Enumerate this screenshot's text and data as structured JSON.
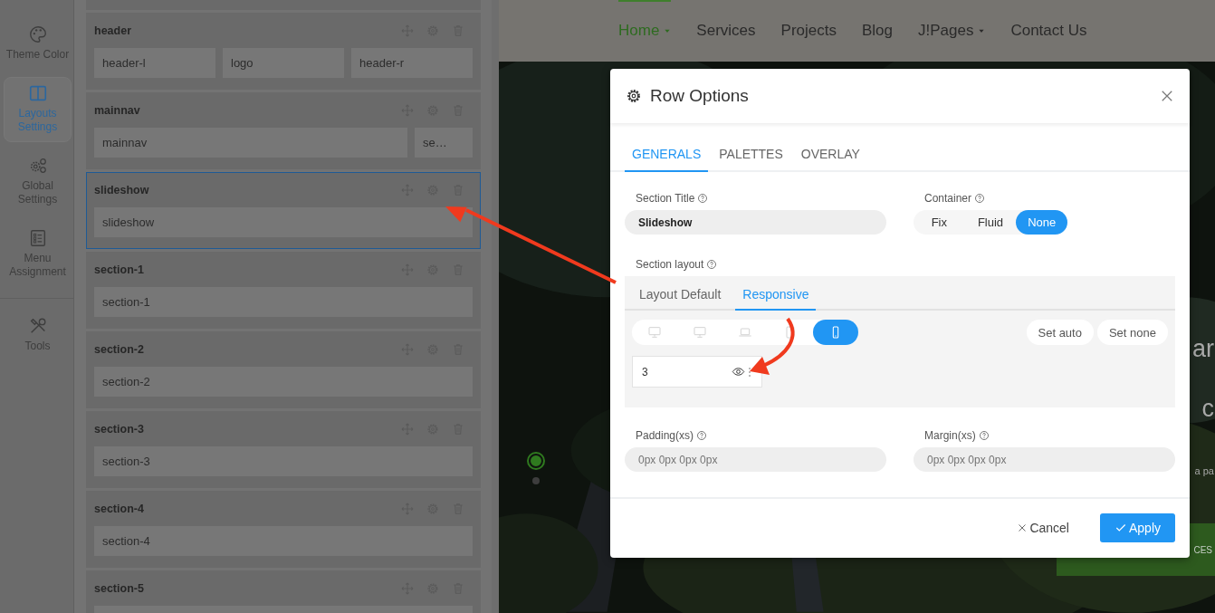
{
  "sidebar": {
    "items": [
      {
        "label": "Theme Color",
        "kind": "palette",
        "selected": false
      },
      {
        "label": "Layouts Settings",
        "kind": "columns",
        "selected": true
      },
      {
        "label": "Global Settings",
        "kind": "gears",
        "selected": false
      },
      {
        "label": "Menu Assignment",
        "kind": "checklist",
        "selected": false
      },
      {
        "label": "Tools",
        "kind": "tools",
        "selected": false
      }
    ]
  },
  "layout_rows": [
    {
      "title": "header",
      "selected": false,
      "columns": [
        "header-l",
        "logo",
        "header-r"
      ]
    },
    {
      "title": "mainnav",
      "selected": false,
      "columns": [
        "mainnav",
        "se…"
      ]
    },
    {
      "title": "slideshow",
      "selected": true,
      "columns": [
        "slideshow"
      ]
    },
    {
      "title": "section-1",
      "selected": false,
      "columns": [
        "section-1"
      ]
    },
    {
      "title": "section-2",
      "selected": false,
      "columns": [
        "section-2"
      ]
    },
    {
      "title": "section-3",
      "selected": false,
      "columns": [
        "section-3"
      ]
    },
    {
      "title": "section-4",
      "selected": false,
      "columns": [
        "section-4"
      ]
    },
    {
      "title": "section-5",
      "selected": false,
      "columns": []
    }
  ],
  "preview": {
    "nav": [
      {
        "label": "Home",
        "selected": true,
        "dropdown": true
      },
      {
        "label": "Services",
        "selected": false,
        "dropdown": false
      },
      {
        "label": "Projects",
        "selected": false,
        "dropdown": false
      },
      {
        "label": "Blog",
        "selected": false,
        "dropdown": false
      },
      {
        "label": "J!Pages",
        "selected": false,
        "dropdown": true
      },
      {
        "label": "Contact Us",
        "selected": false,
        "dropdown": false
      }
    ],
    "hero_texts": [
      "ar",
      "c",
      "a pa"
    ],
    "hero_button": "CES",
    "slider_dots": [
      {
        "selected": true
      },
      {
        "selected": false
      }
    ]
  },
  "modal": {
    "title": "Row Options",
    "tabs": [
      {
        "label": "GENERALS",
        "selected": true
      },
      {
        "label": "PALETTES",
        "selected": false
      },
      {
        "label": "OVERLAY",
        "selected": false
      }
    ],
    "section_title": {
      "label": "Section Title",
      "value": "Slideshow"
    },
    "container": {
      "label": "Container",
      "options": [
        {
          "label": "Fix",
          "selected": false
        },
        {
          "label": "Fluid",
          "selected": false
        },
        {
          "label": "None",
          "selected": true
        }
      ]
    },
    "section_layout": {
      "label": "Section layout",
      "tabs": [
        {
          "label": "Layout Default",
          "selected": false
        },
        {
          "label": "Responsive",
          "selected": true
        }
      ],
      "devices": [
        {
          "kind": "desktop",
          "selected": false
        },
        {
          "kind": "desktop",
          "selected": false
        },
        {
          "kind": "laptop",
          "selected": false
        },
        {
          "kind": "tablet",
          "selected": false
        },
        {
          "kind": "phone",
          "selected": true
        }
      ],
      "buttons": [
        "Set auto",
        "Set none"
      ],
      "columns": [
        {
          "value": "3"
        }
      ]
    },
    "padding": {
      "label": "Padding(xs)",
      "placeholder": "0px 0px 0px 0px"
    },
    "margin": {
      "label": "Margin(xs)",
      "placeholder": "0px 0px 0px 0px"
    },
    "buttons": [
      {
        "label": "Cancel",
        "kind": "cancel"
      },
      {
        "label": "Apply",
        "kind": "apply"
      }
    ]
  }
}
